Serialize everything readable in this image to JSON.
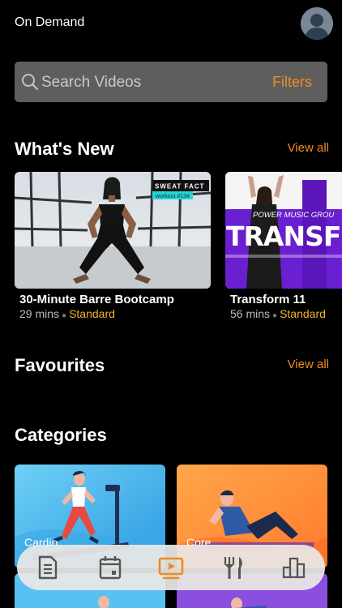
{
  "header": {
    "title": "On Demand",
    "avatar_icon": "user-avatar-icon"
  },
  "search": {
    "placeholder": "Search Videos",
    "filters_label": "Filters",
    "icon": "search-icon"
  },
  "sections": {
    "whats_new": {
      "title": "What's New",
      "view_all": "View all",
      "cards": [
        {
          "title": "30-Minute Barre Bootcamp",
          "duration": "29 mins",
          "level": "Standard",
          "overlay_brand": "SWEAT FACT",
          "overlay_tag": "workout #134"
        },
        {
          "title": "Transform 11",
          "duration": "56 mins",
          "level": "Standard",
          "overlay_brand": "POWER MUSIC GROU",
          "overlay_word": "TRANSF"
        }
      ]
    },
    "favourites": {
      "title": "Favourites",
      "view_all": "View all"
    },
    "categories": {
      "title": "Categories",
      "items": [
        {
          "label": "Cardio"
        },
        {
          "label": "Core"
        }
      ]
    }
  },
  "tabbar": {
    "items": [
      {
        "name": "notes",
        "icon": "document-icon"
      },
      {
        "name": "schedule",
        "icon": "calendar-icon"
      },
      {
        "name": "on-demand",
        "icon": "video-play-icon",
        "active": true
      },
      {
        "name": "nutrition",
        "icon": "fork-knife-icon"
      },
      {
        "name": "stats",
        "icon": "bar-chart-icon"
      }
    ]
  },
  "colors": {
    "accent": "#f08a24",
    "level": "#f0b429",
    "background": "#000000"
  }
}
